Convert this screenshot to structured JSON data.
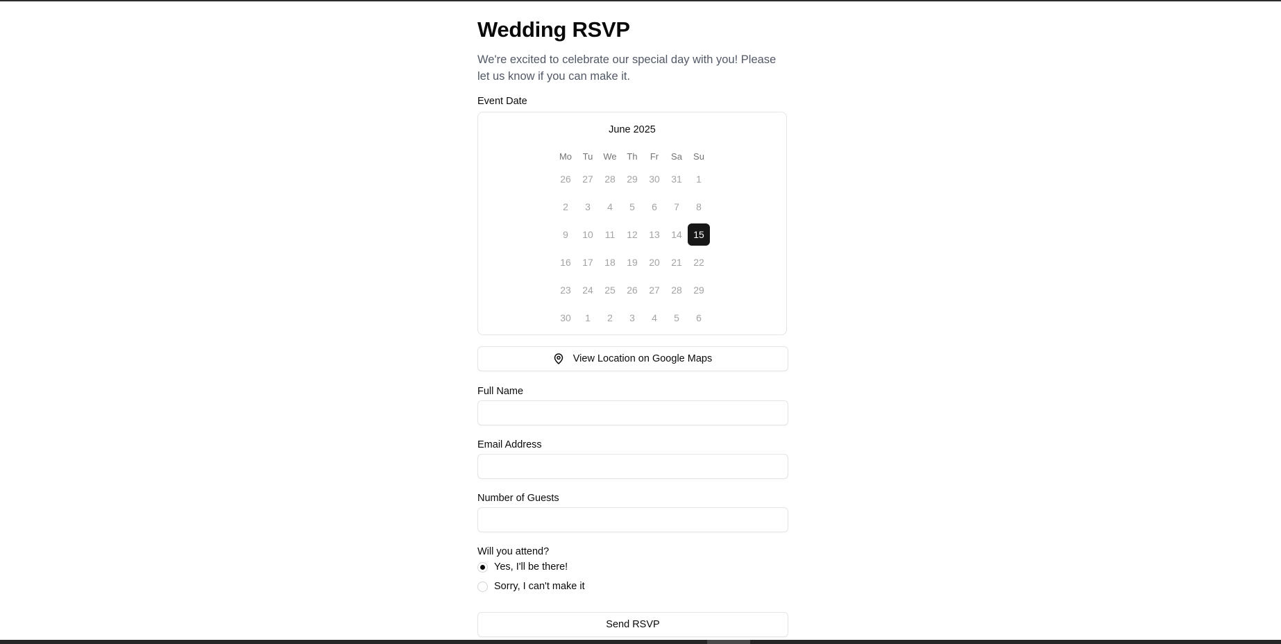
{
  "page": {
    "title": "Wedding RSVP",
    "subtitle": "We're excited to celebrate our special day with you! Please let us know if you can make it."
  },
  "event_date": {
    "label": "Event Date",
    "calendar": {
      "caption": "June 2025",
      "weekdays": [
        "Mo",
        "Tu",
        "We",
        "Th",
        "Fr",
        "Sa",
        "Su"
      ],
      "weeks": [
        [
          "26",
          "27",
          "28",
          "29",
          "30",
          "31",
          "1"
        ],
        [
          "2",
          "3",
          "4",
          "5",
          "6",
          "7",
          "8"
        ],
        [
          "9",
          "10",
          "11",
          "12",
          "13",
          "14",
          "15"
        ],
        [
          "16",
          "17",
          "18",
          "19",
          "20",
          "21",
          "22"
        ],
        [
          "23",
          "24",
          "25",
          "26",
          "27",
          "28",
          "29"
        ],
        [
          "30",
          "1",
          "2",
          "3",
          "4",
          "5",
          "6"
        ]
      ],
      "selected": "15"
    }
  },
  "location_button": {
    "label": "View Location on Google Maps",
    "icon": "map-pin-icon"
  },
  "form": {
    "full_name": {
      "label": "Full Name",
      "value": "",
      "placeholder": ""
    },
    "email": {
      "label": "Email Address",
      "value": "",
      "placeholder": ""
    },
    "guests": {
      "label": "Number of Guests",
      "value": "",
      "placeholder": ""
    },
    "attend": {
      "label": "Will you attend?",
      "options": [
        {
          "label": "Yes, I'll be there!",
          "checked": true
        },
        {
          "label": "Sorry, I can't make it",
          "checked": false
        }
      ]
    },
    "submit_label": "Send RSVP"
  },
  "colors": {
    "selected_day_bg": "#171717",
    "muted_text": "#525866",
    "border": "#e5e5e5"
  }
}
